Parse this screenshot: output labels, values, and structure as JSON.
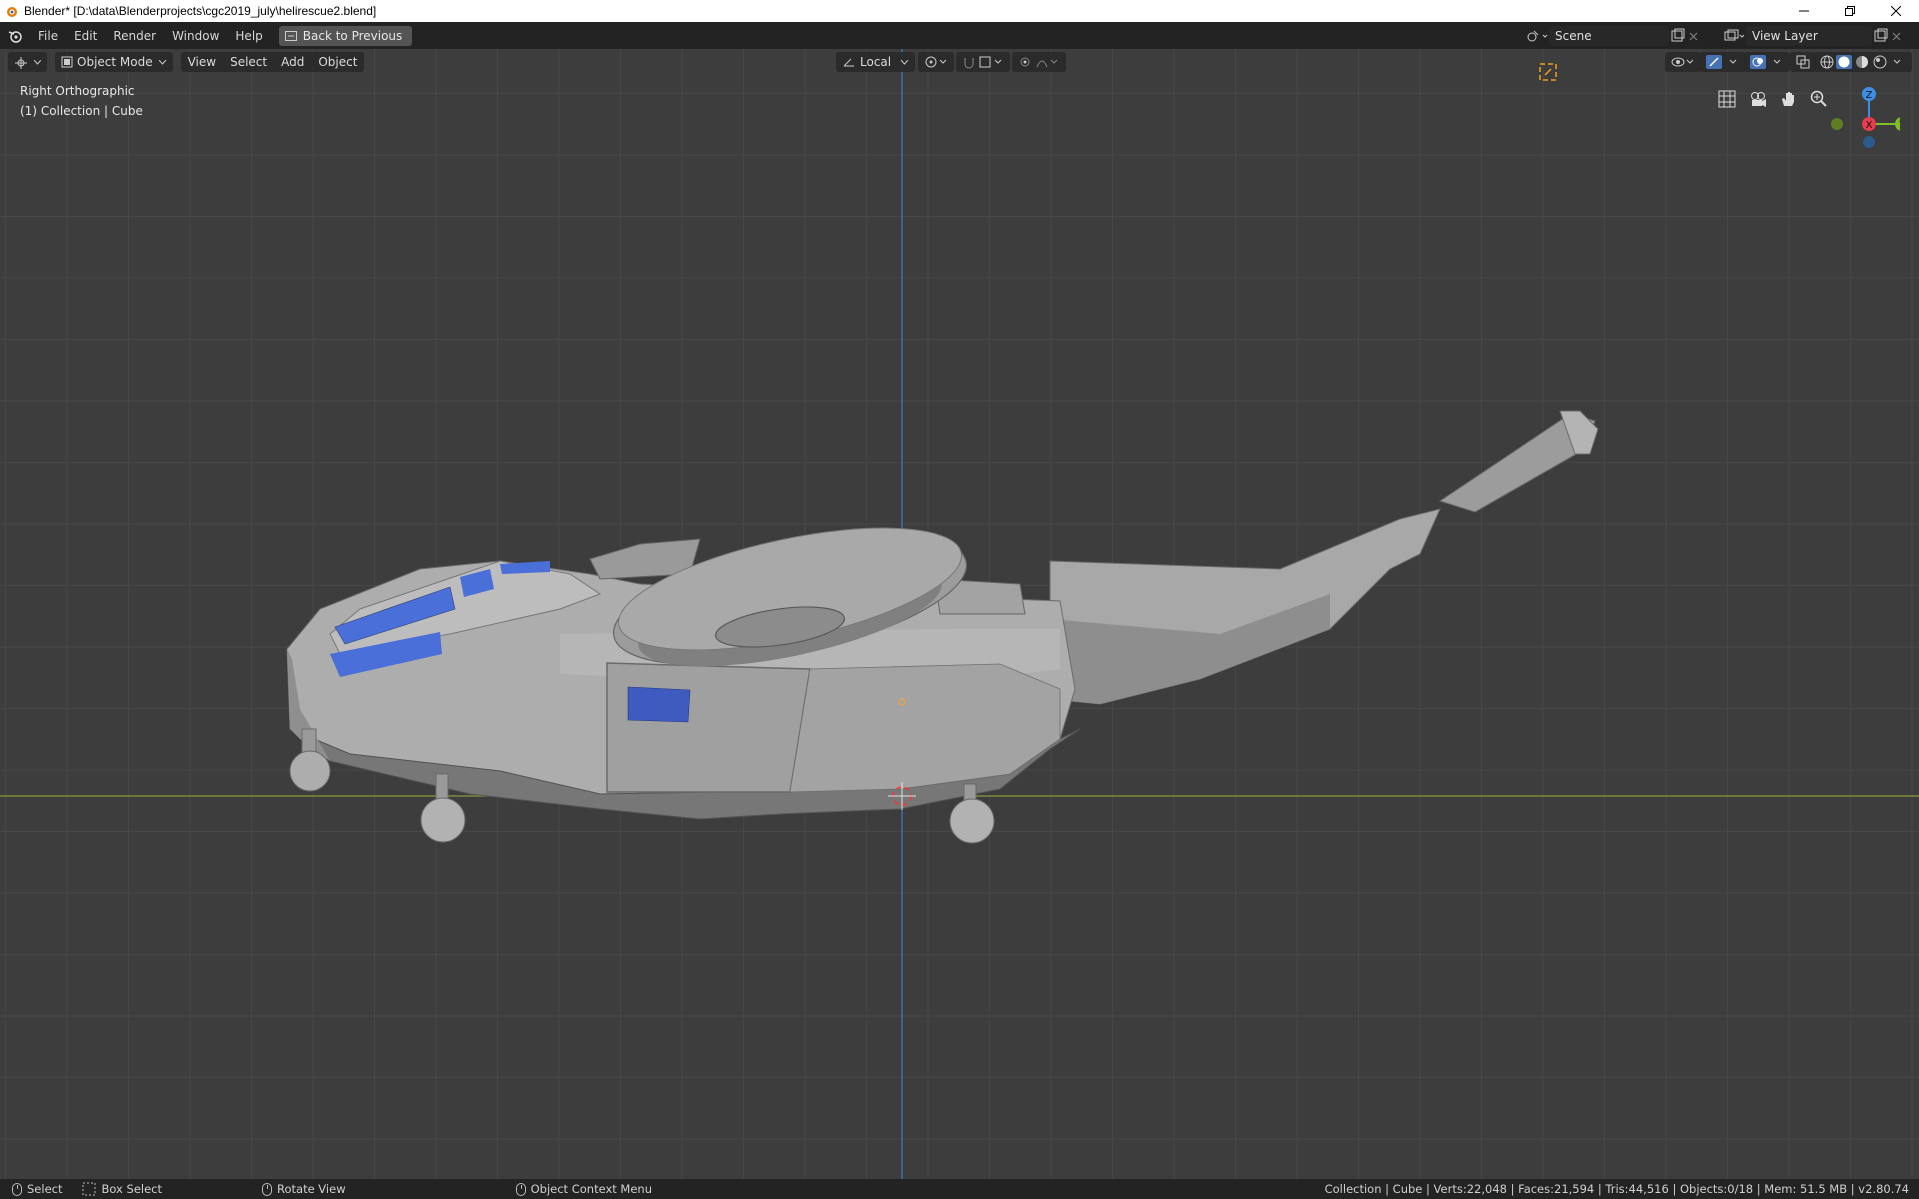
{
  "window": {
    "title": "Blender* [D:\\data\\Blenderprojects\\cgc2019_july\\helirescue2.blend]"
  },
  "topbar": {
    "menus": [
      "File",
      "Edit",
      "Render",
      "Window",
      "Help"
    ],
    "back_label": "Back to Previous",
    "scene_name": "Scene",
    "view_layer_name": "View Layer"
  },
  "viewport_header": {
    "mode": "Object Mode",
    "menus": [
      "View",
      "Select",
      "Add",
      "Object"
    ],
    "orientation": "Local"
  },
  "viewport": {
    "view_name": "Right Orthographic",
    "collection_info": "(1) Collection | Cube",
    "gizmo": {
      "z": "Z",
      "x": "X",
      "y": "Y"
    }
  },
  "statusbar": {
    "select": "Select",
    "box_select": "Box Select",
    "rotate_view": "Rotate View",
    "context_menu": "Object Context Menu",
    "stats": "Collection | Cube | Verts:22,048 | Faces:21,594 | Tris:44,516 | Objects:0/18 | Mem: 51.5 MB | v2.80.74"
  },
  "colors": {
    "accent_blue": "#4a6fd8",
    "axis_x": "#e53e4f",
    "axis_y": "#7fbf2a",
    "axis_z": "#3d8ee3",
    "model_gray": "#a6a6a6"
  }
}
